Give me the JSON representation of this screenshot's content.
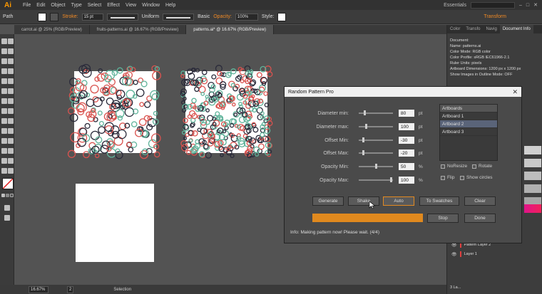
{
  "app": {
    "logo": "Ai",
    "menu": [
      "File",
      "Edit",
      "Object",
      "Type",
      "Select",
      "Effect",
      "View",
      "Window",
      "Help"
    ],
    "workspace": "Essentials"
  },
  "control_bar": {
    "path_label": "Path",
    "stroke_label": "Stroke:",
    "stroke_value": "15 pt",
    "profile_uniform": "Uniform",
    "profile_basic": "Basic",
    "opacity_label": "Opacity:",
    "opacity_value": "100%",
    "style_label": "Style:",
    "transform_label": "Transform"
  },
  "tabs": [
    {
      "label": "carrot.ai @ 25% (RGB/Preview)",
      "active": false
    },
    {
      "label": "fruits-patterns.ai @ 16.67% (RGB/Preview)",
      "active": false
    },
    {
      "label": "patterns.ai* @ 16.67% (RGB/Preview)",
      "active": true
    }
  ],
  "right_panel": {
    "tabs": [
      "Color",
      "Transfo",
      "Navig",
      "Document Info"
    ],
    "document_info": [
      "Document:",
      "Name: patterns.ai",
      "Color Mode: RGB color",
      "Color Profile: sRGB IEC61966-2.1",
      "Ruler Units: pixels",
      "Artboard Dimensions: 1200 px x 1200 px",
      "Show Images in Outline Mode: OFF"
    ],
    "layers": [
      "Pattern Layer 2",
      "Layer 1"
    ],
    "layers_count": "3 La..."
  },
  "status_bar": {
    "zoom": "16.67%",
    "artboard_num": "2",
    "selection": "Selection"
  },
  "dialog": {
    "title": "Random Pattern Pro",
    "params": [
      {
        "label": "Diameter min:",
        "value": "80",
        "unit": "pt",
        "pos": 0.15
      },
      {
        "label": "Diameter max:",
        "value": "100",
        "unit": "pt",
        "pos": 0.2
      },
      {
        "label": "Offset Min:",
        "value": "-30",
        "unit": "pt",
        "pos": 0.1
      },
      {
        "label": "Offset Max:",
        "value": "-20",
        "unit": "pt",
        "pos": 0.12
      },
      {
        "label": "Opacity Min:",
        "value": "50",
        "unit": "%",
        "pos": 0.5
      },
      {
        "label": "Opacity Max:",
        "value": "100",
        "unit": "%",
        "pos": 0.97
      }
    ],
    "artboards_header": "Artboards",
    "artboards": [
      "Artboard 1",
      "Artboard 2",
      "Artboard 3"
    ],
    "selected_artboard": 1,
    "options": {
      "noresize": "NoResize",
      "rotate": "Rotate",
      "flip": "Flip",
      "show_circles": "Show circles"
    },
    "buttons": {
      "generate": "Generate",
      "shake": "Shake",
      "auto": "Auto",
      "to_swatches": "To Swatches",
      "clear": "Clear",
      "stop": "Stop",
      "done": "Done"
    },
    "progress": 1.0,
    "info": "Info:    Making pattern now! Please wait. (4/4)"
  },
  "colors": {
    "accent": "#e0891e",
    "circle_red": "#d9534f",
    "circle_teal": "#5fb39a",
    "circle_dark": "#2a2a3a"
  }
}
